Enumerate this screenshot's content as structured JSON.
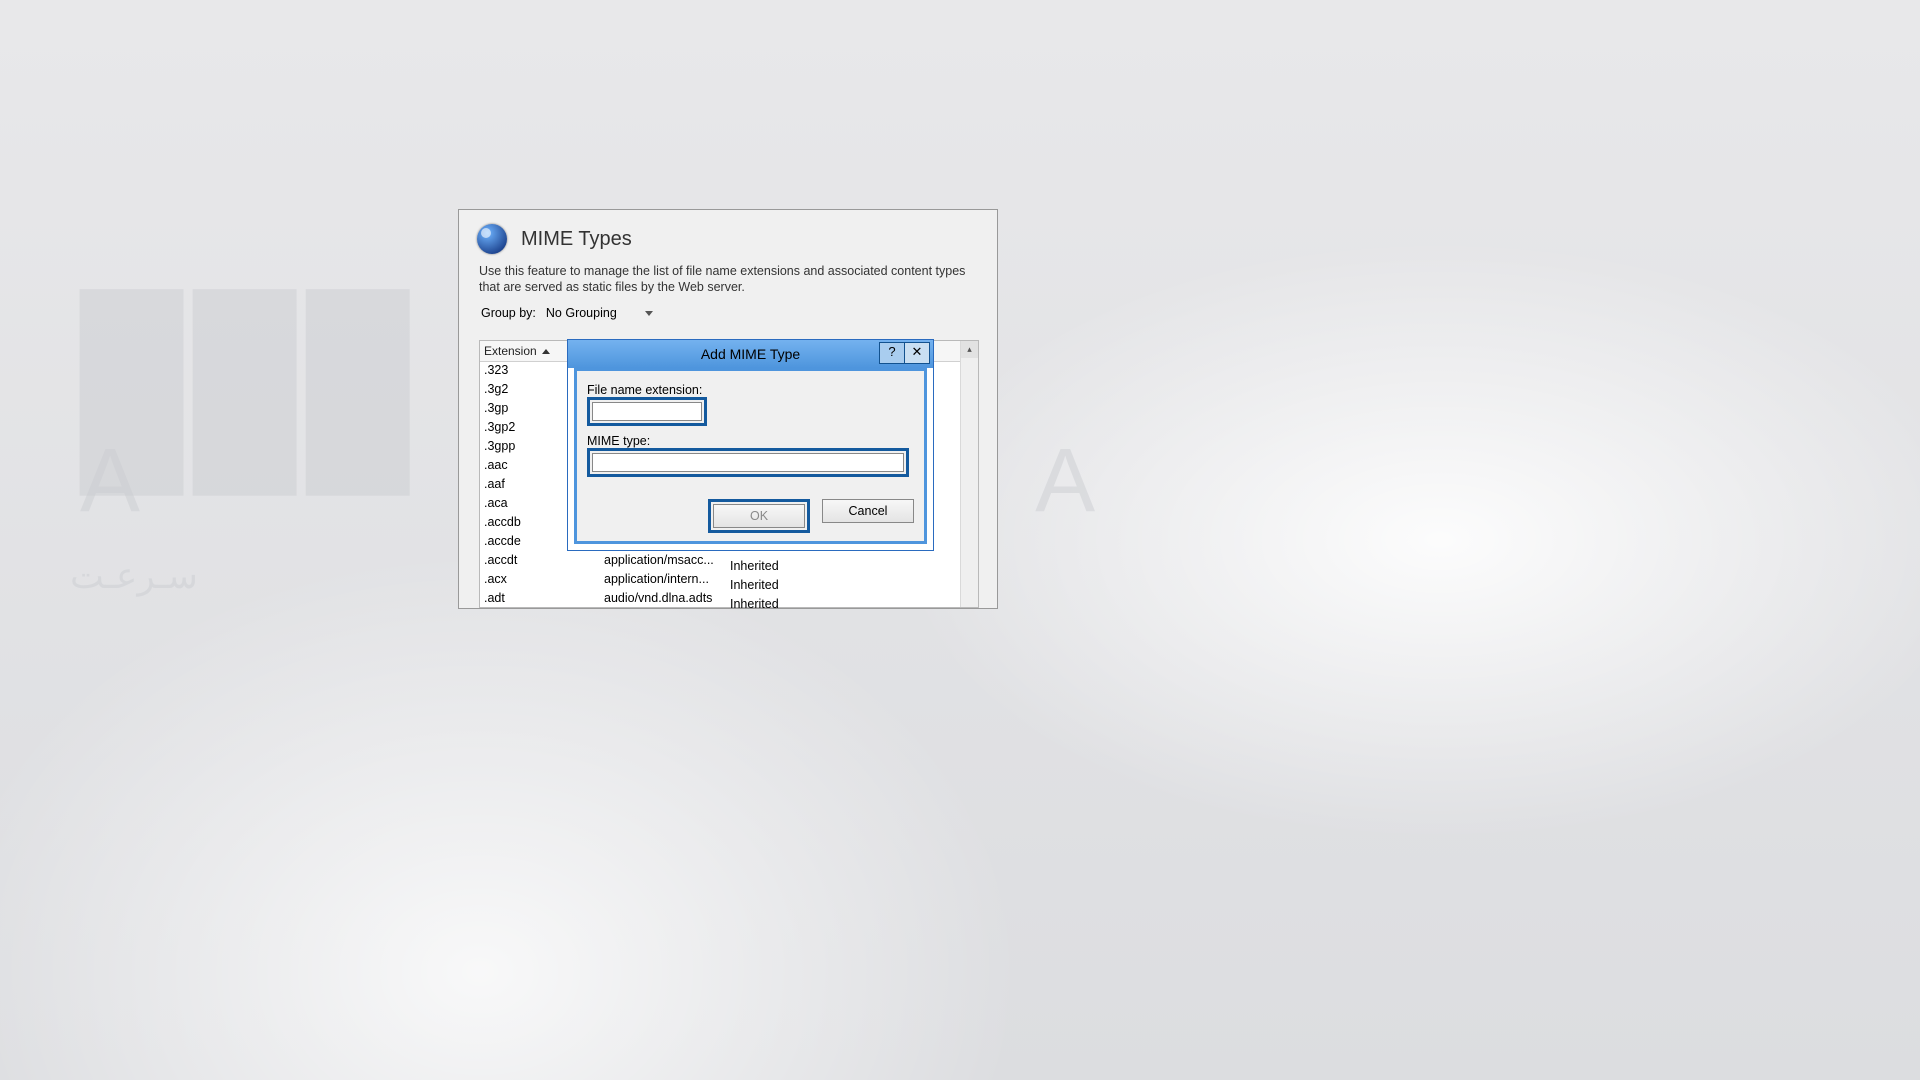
{
  "watermark": {
    "blocks": "▮▮▮",
    "letters": "A Z A",
    "arabic": "سـرعـت"
  },
  "pane": {
    "title": "MIME Types",
    "description": "Use this feature to manage the list of file name extensions and associated content types that are served as static files by the Web server.",
    "group_by_label": "Group by:",
    "group_by_value": "No Grouping",
    "columns": {
      "extension": "Extension"
    },
    "rows": [
      {
        "ext": ".323",
        "mime": "",
        "entry": ""
      },
      {
        "ext": ".3g2",
        "mime": "",
        "entry": ""
      },
      {
        "ext": ".3gp",
        "mime": "",
        "entry": ""
      },
      {
        "ext": ".3gp2",
        "mime": "",
        "entry": ""
      },
      {
        "ext": ".3gpp",
        "mime": "",
        "entry": ""
      },
      {
        "ext": ".aac",
        "mime": "",
        "entry": ""
      },
      {
        "ext": ".aaf",
        "mime": "",
        "entry": ""
      },
      {
        "ext": ".aca",
        "mime": "",
        "entry": ""
      },
      {
        "ext": ".accdb",
        "mime": "",
        "entry": ""
      },
      {
        "ext": ".accde",
        "mime": "",
        "entry": ""
      },
      {
        "ext": ".accdt",
        "mime": "application/msacc...",
        "entry": "Inherited"
      },
      {
        "ext": ".acx",
        "mime": "application/intern...",
        "entry": "Inherited"
      },
      {
        "ext": ".adt",
        "mime": "audio/vnd.dlna.adts",
        "entry": "Inherited"
      }
    ]
  },
  "dialog": {
    "title": "Add MIME Type",
    "help": "?",
    "close": "✕",
    "ext_label": "File name extension:",
    "ext_value": "",
    "mime_label": "MIME type:",
    "mime_value": "",
    "ok": "OK",
    "cancel": "Cancel"
  }
}
